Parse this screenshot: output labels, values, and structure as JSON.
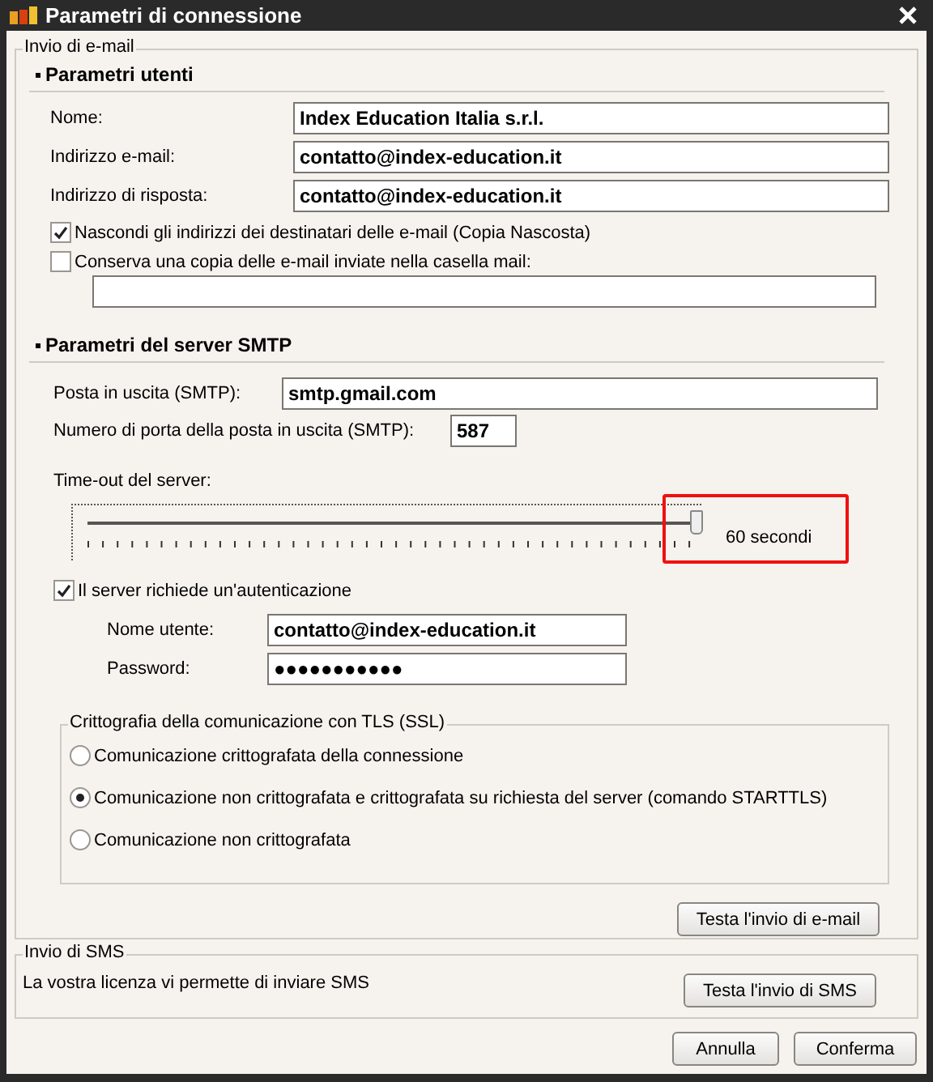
{
  "window": {
    "title": "Parametri di connessione"
  },
  "email_group": {
    "legend": "Invio di e-mail",
    "user_section": {
      "heading": "Parametri utenti",
      "fields": [
        {
          "label": "Nome:",
          "value": "Index Education Italia s.r.l."
        },
        {
          "label": "Indirizzo e-mail:",
          "value": "contatto@index-education.it"
        },
        {
          "label": "Indirizzo di risposta:",
          "value": "contatto@index-education.it"
        }
      ],
      "checkboxes": [
        {
          "label": "Nascondi gli indirizzi dei destinatari delle e-mail (Copia Nascosta)",
          "checked": true
        },
        {
          "label": "Conserva una copia delle e-mail inviate nella casella mail:",
          "checked": false
        }
      ]
    },
    "smtp_section": {
      "heading": "Parametri del server SMTP",
      "server": {
        "label": "Posta in uscita (SMTP):",
        "value": "smtp.gmail.com"
      },
      "port": {
        "label": "Numero di porta della posta in uscita (SMTP):",
        "value": "587"
      },
      "timeout": {
        "label": "Time-out del server:",
        "level": 1,
        "reading": "60 secondi"
      },
      "auth": {
        "label": "Il server richiede un'autenticazione",
        "checked": true
      },
      "auth_fields": [
        {
          "label": "Nome utente:",
          "value": "contatto@index-education.it"
        },
        {
          "label": "Password:",
          "value": "●●●●●●●●●●●"
        }
      ],
      "tls": {
        "legend": "Crittografia della comunicazione con TLS (SSL)",
        "options": [
          {
            "label": "Comunicazione crittografata della connessione",
            "selected": false
          },
          {
            "label": "Comunicazione non crittografata e crittografata su richiesta del server (comando STARTTLS)",
            "selected": true
          },
          {
            "label": "Comunicazione non crittografata",
            "selected": false
          }
        ]
      },
      "test_button": "Testa l'invio di e-mail"
    }
  },
  "sms_group": {
    "legend": "Invio di SMS",
    "text": "La vostra licenza vi permette di inviare SMS",
    "button": "Testa l'invio di SMS"
  },
  "buttons": [
    "Annulla",
    "Conferma"
  ]
}
